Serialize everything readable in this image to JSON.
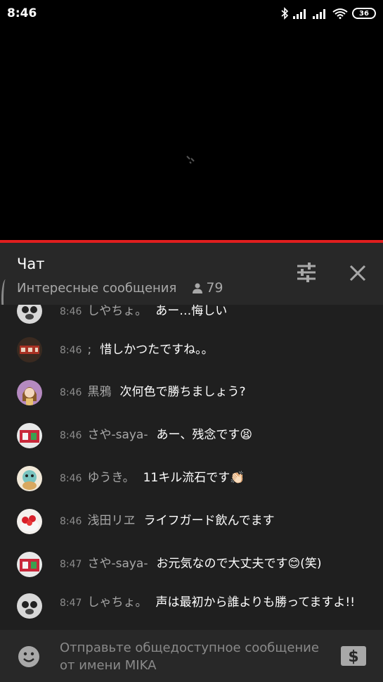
{
  "status_bar": {
    "time": "8:46",
    "battery": "36"
  },
  "chat": {
    "title": "Чат",
    "mode": "Интересные сообщения",
    "viewer_count": "79"
  },
  "messages": [
    {
      "time": "8:46",
      "author": "しやちょ。",
      "text": "あー…悔しい"
    },
    {
      "time": "8:46",
      "author": ";",
      "text": "惜しかつたですね。。"
    },
    {
      "time": "8:46",
      "author": "黒鴉",
      "text": "次何色で勝ちましょう?"
    },
    {
      "time": "8:46",
      "author": "さや-saya-",
      "text": "あー、残念です😫"
    },
    {
      "time": "8:46",
      "author": "ゆうき。",
      "text": "11キル流石です👏🏻"
    },
    {
      "time": "8:46",
      "author": "浅田リヱ",
      "text": "ライフガード飲んでます"
    },
    {
      "time": "8:47",
      "author": "さや-saya-",
      "text": "お元気なので大丈夫です😊(笑)"
    },
    {
      "time": "8:47",
      "author": "しゃちょ。",
      "text": "声は最初から誰よりも勝ってますよ!!"
    }
  ],
  "input": {
    "placeholder": "Отправьте общедоступное сообщение от имени MIKA"
  },
  "icons": {
    "bluetooth": "bluetooth-icon",
    "signal": "signal-icon",
    "wifi": "wifi-icon",
    "viewers": "person-icon",
    "filter": "sliders-icon",
    "close": "close-icon",
    "emoji": "emoji-icon",
    "super_chat": "dollar-icon"
  },
  "colors": {
    "accent": "#e01e1e",
    "panel": "#282828",
    "chat_bg": "#1f1f1f"
  }
}
